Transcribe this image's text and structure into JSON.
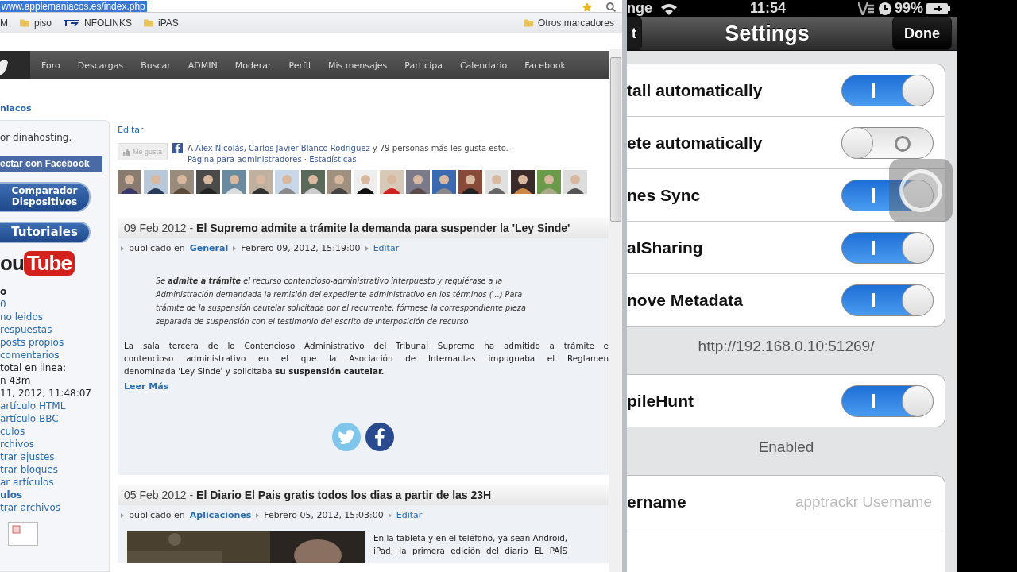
{
  "browser": {
    "url": "www.applemaniacos.es/index.php",
    "bookmarks": [
      {
        "label": "M",
        "kind": "text"
      },
      {
        "label": "piso",
        "kind": "folder"
      },
      {
        "label": "NFOLINKS",
        "kind": "link"
      },
      {
        "label": "iPAS",
        "kind": "folder"
      }
    ],
    "other_bookmarks": "Otros marcadores"
  },
  "site": {
    "nav": [
      "Foro",
      "Descargas",
      "Buscar",
      "ADMIN",
      "Moderar",
      "Perfil",
      "Mis mensajes",
      "Participa",
      "Calendario",
      "Facebook"
    ],
    "site_name": "niacos",
    "sidebar": {
      "sponsor": "or dinahosting.",
      "facebook_button": "ectar con Facebook",
      "banners": [
        {
          "lines": [
            "Comparador",
            "Dispositivos"
          ]
        },
        {
          "lines": [
            "Tutoriales"
          ]
        }
      ],
      "youtube": {
        "left": "ou",
        "right": "Tube"
      },
      "links": [
        {
          "text": "o",
          "kind": "heading"
        },
        {
          "text": "0",
          "kind": "link"
        },
        {
          "text": "no leidos",
          "kind": "link"
        },
        {
          "text": "respuestas",
          "kind": "link"
        },
        {
          "text": "posts propios",
          "kind": "link"
        },
        {
          "text": "comentarios",
          "kind": "link"
        },
        {
          "text": "total en linea:",
          "kind": "text"
        },
        {
          "text": "n 43m",
          "kind": "text"
        },
        {
          "text": "11, 2012, 11:48:07",
          "kind": "text"
        },
        {
          "text": "artículo HTML",
          "kind": "link"
        },
        {
          "text": "artículo BBC",
          "kind": "link"
        },
        {
          "text": "culos",
          "kind": "link"
        },
        {
          "text": "rchivos",
          "kind": "link"
        },
        {
          "text": "trar ajustes",
          "kind": "link"
        },
        {
          "text": "trar bloques",
          "kind": "link"
        },
        {
          "text": "ar artículos",
          "kind": "link"
        },
        {
          "text": "ulos",
          "kind": "heading-link"
        },
        {
          "text": "trar archivos",
          "kind": "link"
        }
      ]
    },
    "edit_link": "Editar",
    "like_box": {
      "button": "Me gusta",
      "segments": [
        {
          "text": "A ",
          "kind": "text"
        },
        {
          "text": "Alex Nicolás",
          "kind": "link"
        },
        {
          "text": ", ",
          "kind": "text"
        },
        {
          "text": "Carlos Javier Blanco Rodriguez",
          "kind": "link"
        },
        {
          "text": " y 79 personas más les gusta esto. · ",
          "kind": "text"
        },
        {
          "text": "Página para administradores",
          "kind": "link"
        },
        {
          "text": " · ",
          "kind": "text"
        },
        {
          "text": "Estadísticas",
          "kind": "link"
        }
      ]
    },
    "fans": [
      {
        "kind": "picture"
      },
      {
        "kind": "picture"
      },
      {
        "kind": "picture"
      },
      {
        "kind": "picture"
      },
      {
        "kind": "picture"
      },
      {
        "kind": "picture"
      },
      {
        "kind": "picture"
      },
      {
        "kind": "picture"
      },
      {
        "kind": "picture"
      },
      {
        "kind": "picture"
      },
      {
        "kind": "picture"
      },
      {
        "kind": "picture"
      },
      {
        "kind": "picture"
      },
      {
        "kind": "picture"
      },
      {
        "kind": "picture"
      },
      {
        "kind": "picture"
      },
      {
        "kind": "picture"
      },
      {
        "kind": "picture"
      }
    ],
    "articles": [
      {
        "date": "09 Feb 2012 -",
        "title": "El Supremo admite a trámite la demanda para suspender la 'Ley Sinde'",
        "published_label": "publicado en",
        "category": "General",
        "timestamp": "Febrero 09, 2012, 15:19:00",
        "edit": "Editar",
        "quote_lines": [
          "Se **admite a trámite** el recurso contencioso-administrativo interpuesto y requiérase a la",
          "Administración demandada la remisión del expediente administrativo en los términos (...) Para",
          "trámite de la suspensión cautelar solicitada por el recurrente, fórmese la correspondiente pieza",
          "separada de suspensión con el testimonio del escrito de interposición de recurso"
        ],
        "body_lines": [
          "La sala tercera de lo Contencioso Administrativo del Tribunal Supremo ha admitido a trámite e",
          "contencioso administrativo en el que la Asociación de Internautas impugnaba el Reglamen",
          "denominada 'Ley Sinde' y solicitaba **su suspensión cautelar.**"
        ],
        "read_more": "Leer Más",
        "share": true
      },
      {
        "date": "05 Feb 2012 -",
        "title": "El Diario El Pais gratis todos los dias a partir de las 23H",
        "published_label": "publicado en",
        "category": "Aplicaciones",
        "timestamp": "Febrero 05, 2012, 15:03:00",
        "edit": "Editar",
        "image": {
          "kind": "picture"
        },
        "body_lines": [
          "En la tableta y en el teléfono, ya sean Android,",
          "iPad, la primera edición del diario EL PAÍS"
        ],
        "share": false
      }
    ]
  },
  "phone": {
    "status": {
      "carrier": "nge",
      "time": "11:54",
      "battery": "99%"
    },
    "nav": {
      "back": "t",
      "title": "Settings",
      "done": "Done"
    },
    "groups": [
      {
        "rows": [
          {
            "label": "tall automatically",
            "kind": "switch",
            "on": true
          },
          {
            "label": "ete automatically",
            "kind": "switch",
            "on": false
          },
          {
            "label": "nes Sync",
            "kind": "switch",
            "on": true
          },
          {
            "label": "alSharing",
            "kind": "switch",
            "on": true
          },
          {
            "label": "nove Metadata",
            "kind": "switch",
            "on": true
          }
        ],
        "footer": "http://192.168.0.10:51269/"
      },
      {
        "rows": [
          {
            "label": "pileHunt",
            "kind": "switch",
            "on": true
          }
        ],
        "footer": "Enabled"
      },
      {
        "rows": [
          {
            "label": "ername",
            "kind": "field",
            "placeholder": "apptrackr Username"
          },
          {
            "kind": "blank"
          }
        ]
      }
    ]
  }
}
